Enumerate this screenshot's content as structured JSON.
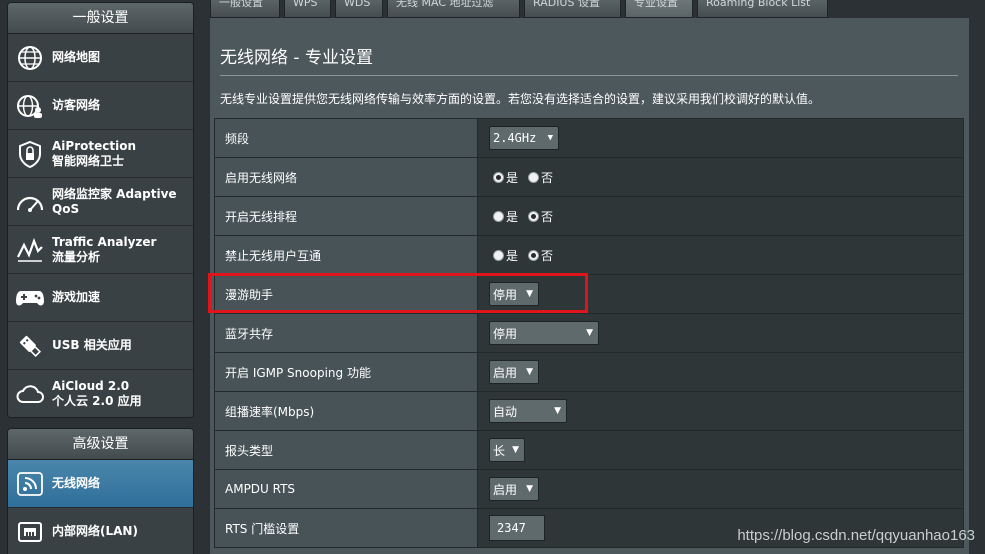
{
  "sidebar": {
    "general_header": "一般设置",
    "general_items": [
      {
        "line1": "网络地图",
        "line2": "",
        "icon": "globe-icon"
      },
      {
        "line1": "访客网络",
        "line2": "",
        "icon": "guest-network-icon"
      },
      {
        "line1": "AiProtection",
        "line2": "智能网络卫士",
        "icon": "shield-lock-icon"
      },
      {
        "line1": "网络监控家 Adaptive",
        "line2": "QoS",
        "icon": "speedometer-icon"
      },
      {
        "line1": "Traffic Analyzer",
        "line2": "流量分析",
        "icon": "traffic-analyzer-icon"
      },
      {
        "line1": "游戏加速",
        "line2": "",
        "icon": "gamepad-icon"
      },
      {
        "line1": "USB 相关应用",
        "line2": "",
        "icon": "usb-icon"
      },
      {
        "line1": "AiCloud 2.0",
        "line2": "个人云 2.0 应用",
        "icon": "cloud-icon"
      }
    ],
    "advanced_header": "高级设置",
    "advanced_items": [
      {
        "line1": "无线网络",
        "line2": "",
        "icon": "wifi-icon",
        "active": true
      },
      {
        "line1": "内部网络(LAN)",
        "line2": "",
        "icon": "lan-icon",
        "active": false
      }
    ]
  },
  "tabs": [
    "一般设置",
    "WPS",
    "WDS",
    "无线 MAC 地址过滤",
    "RADIUS 设置",
    "专业设置",
    "Roaming Block List"
  ],
  "main": {
    "title": "无线网络 - 专业设置",
    "description": "无线专业设置提供您无线网络传输与效率方面的设置。若您没有选择适合的设置，建议采用我们校调好的默认值。",
    "rows": [
      {
        "label": "频段",
        "type": "select",
        "value": "2.4GHz"
      },
      {
        "label": "启用无线网络",
        "type": "radio",
        "yes": "是",
        "no": "否",
        "selected": "yes"
      },
      {
        "label": "开启无线排程",
        "type": "radio",
        "yes": "是",
        "no": "否",
        "selected": "no"
      },
      {
        "label": "禁止无线用户互通",
        "type": "radio",
        "yes": "是",
        "no": "否",
        "selected": "no"
      },
      {
        "label": "漫游助手",
        "type": "select",
        "value": "停用"
      },
      {
        "label": "蓝牙共存",
        "type": "select",
        "value": "停用"
      },
      {
        "label": "开启 IGMP Snooping 功能",
        "type": "select",
        "value": "启用"
      },
      {
        "label": "组播速率(Mbps)",
        "type": "select",
        "value": "自动"
      },
      {
        "label": "报头类型",
        "type": "select",
        "value": "长"
      },
      {
        "label": "AMPDU RTS",
        "type": "select",
        "value": "启用"
      },
      {
        "label": "RTS 门槛设置",
        "type": "input",
        "value": "2347"
      }
    ]
  },
  "watermark": "https://blog.csdn.net/qqyuanhao163",
  "colors": {
    "highlight": "#e0151b",
    "active_item": "#2f6f9a"
  }
}
